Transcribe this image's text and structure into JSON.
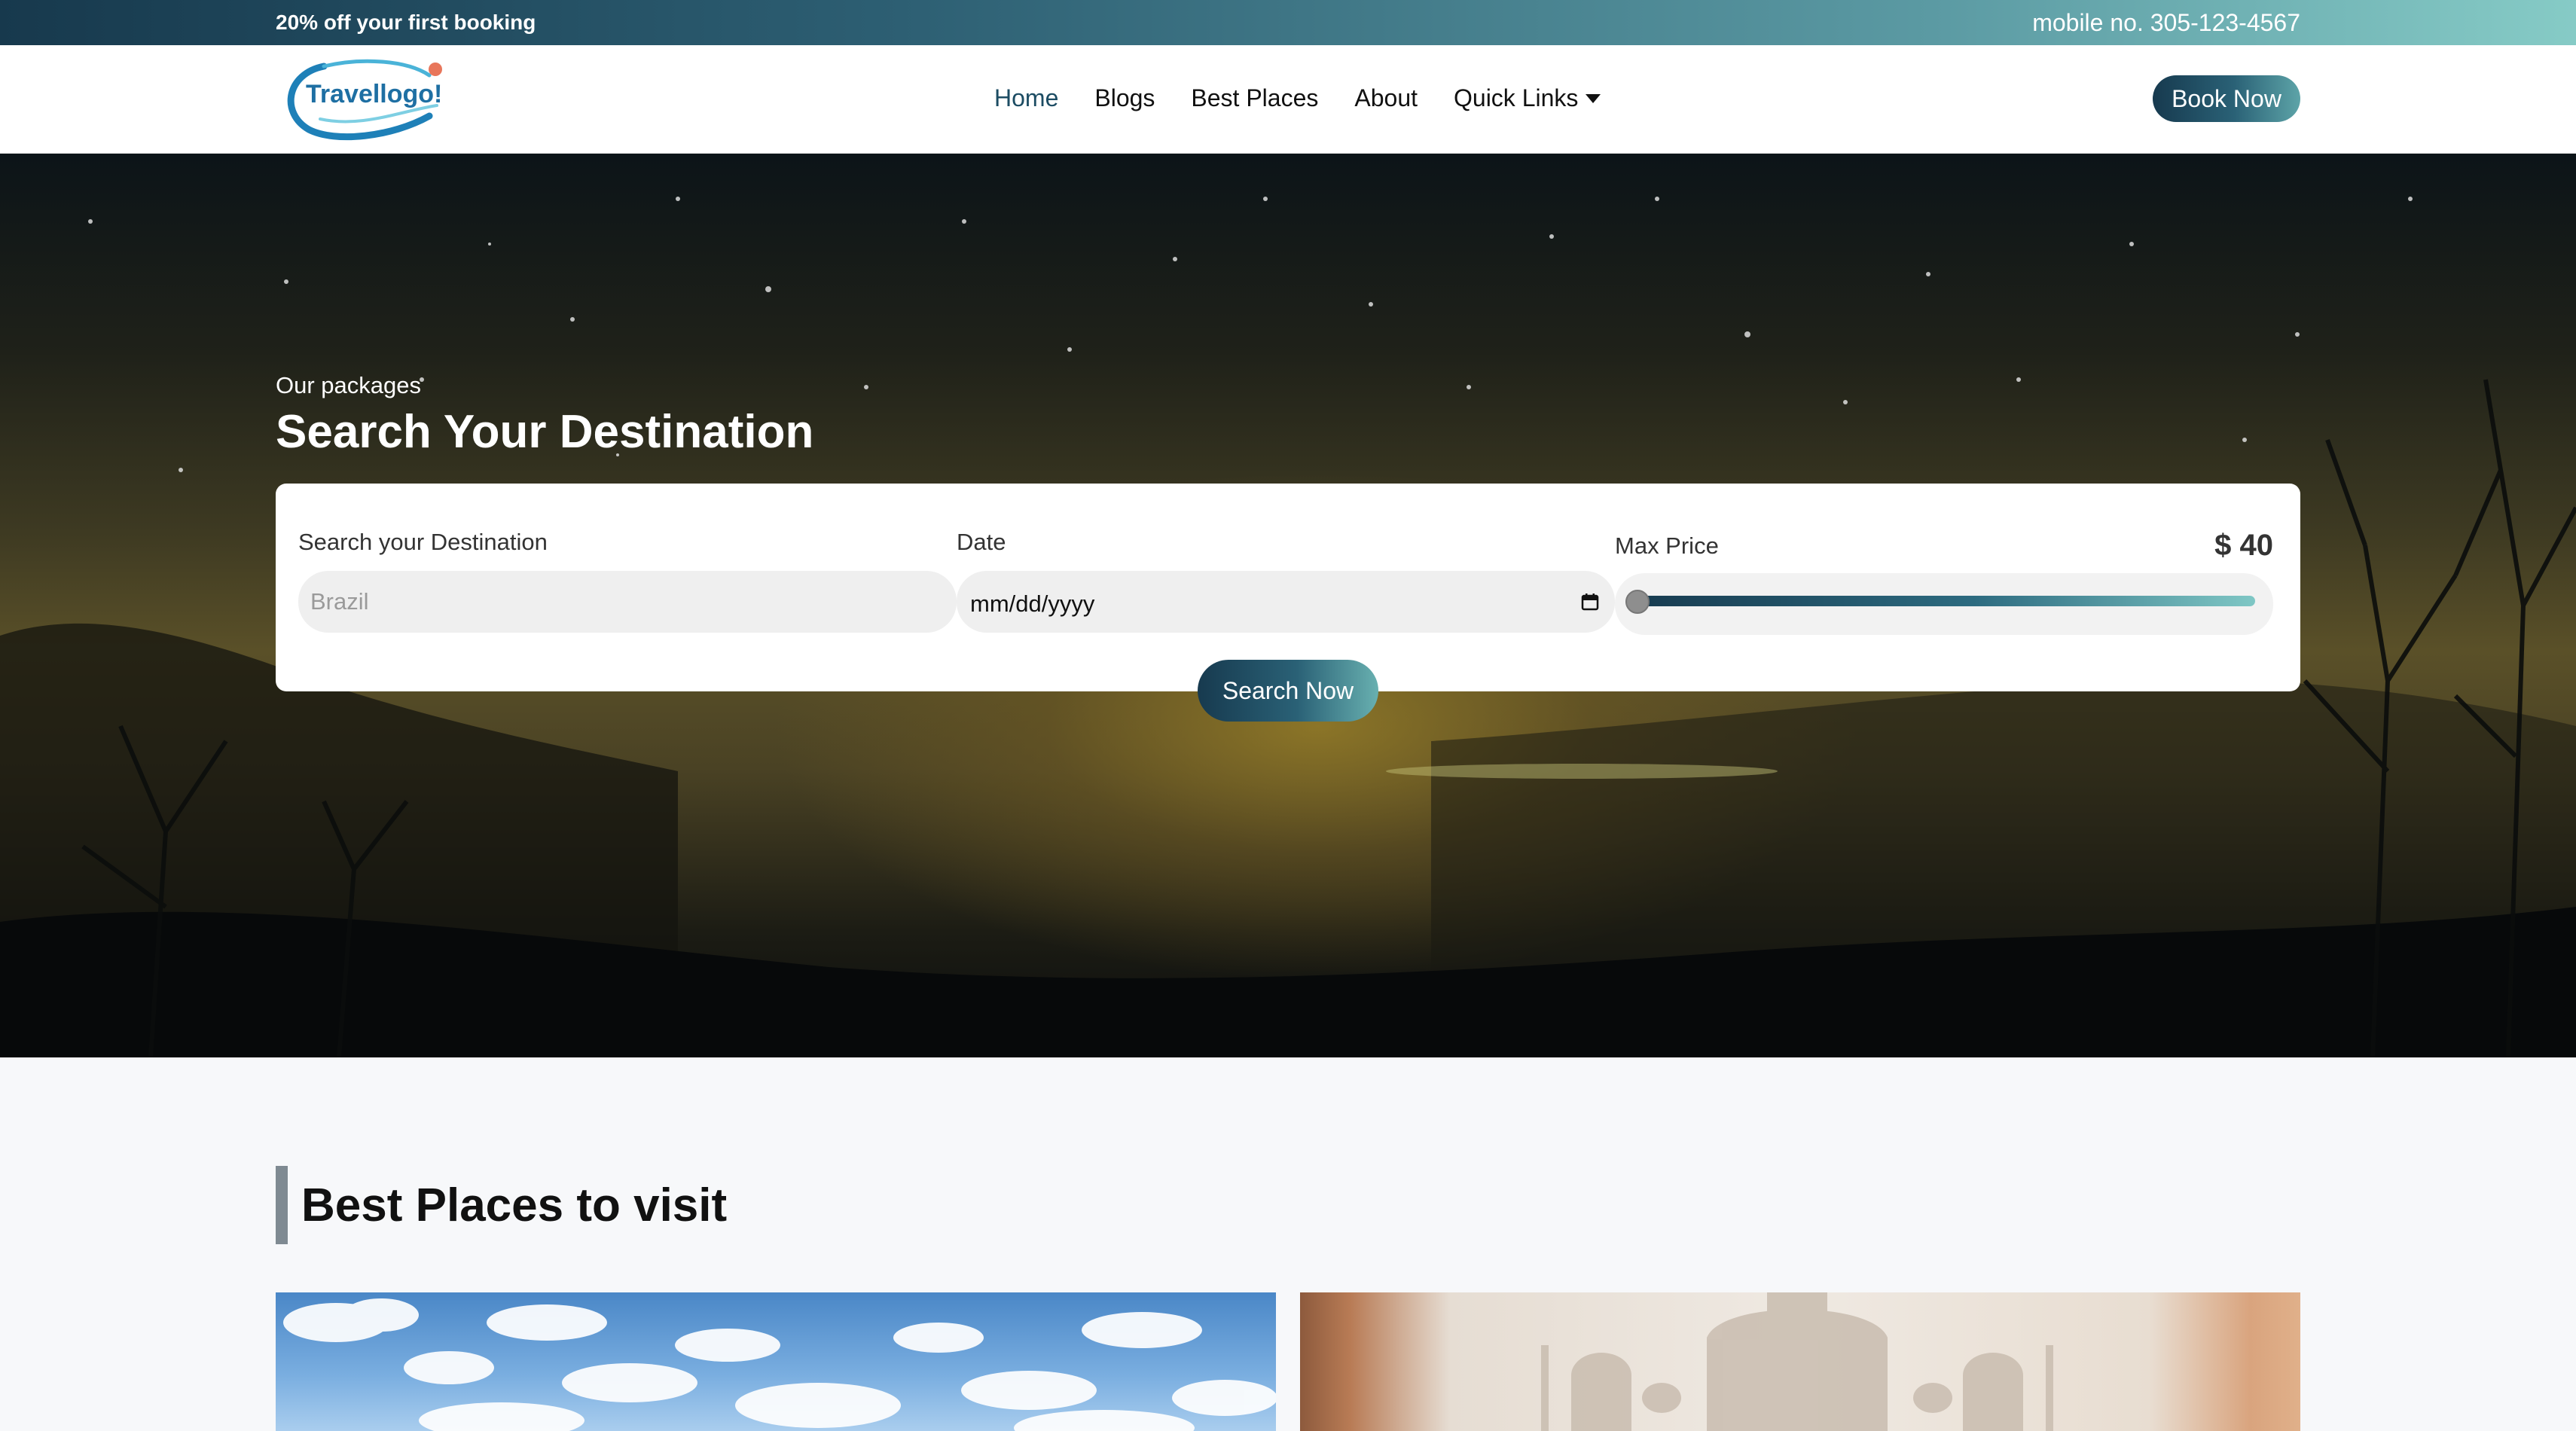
{
  "topbar": {
    "promo": "20% off your first booking",
    "phone": "mobile no. 305-123-4567"
  },
  "navbar": {
    "logo_text": "Travellogo!",
    "links": [
      {
        "label": "Home",
        "active": true
      },
      {
        "label": "Blogs"
      },
      {
        "label": "Best Places"
      },
      {
        "label": "About"
      },
      {
        "label": "Quick Links",
        "dropdown": true
      }
    ],
    "book_label": "Book Now"
  },
  "hero": {
    "subtitle": "Our packages",
    "title": "Search Your Destination",
    "search": {
      "destination_label": "Search your Destination",
      "destination_placeholder": "Brazil",
      "date_label": "Date",
      "date_value": "mm/dd/yyyy",
      "price_label": "Max Price",
      "price_value": "$ 40",
      "price_slider_fraction": 0.0,
      "button_label": "Search Now"
    }
  },
  "best_places": {
    "title": "Best Places to visit"
  },
  "colors": {
    "accent_dark": "#173a4f",
    "accent_light": "#86cbc6",
    "active_nav": "#1c4c63"
  }
}
